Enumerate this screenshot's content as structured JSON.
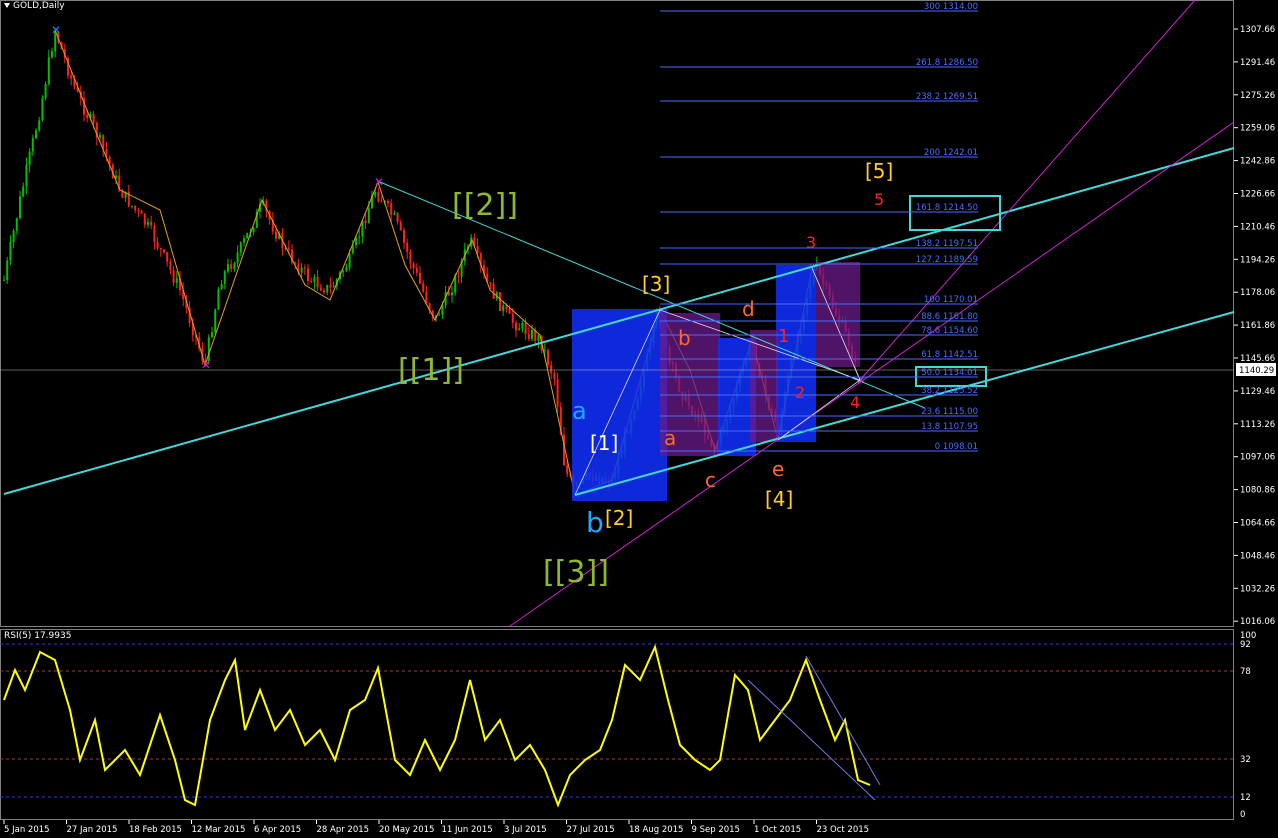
{
  "symbol_title": "GOLD,Daily",
  "rsi_title": "RSI(5) 17.9935",
  "current_price": "1140.29",
  "price_axis": [
    "1307.66",
    "1291.46",
    "1275.26",
    "1259.06",
    "1242.86",
    "1226.66",
    "1210.46",
    "1194.26",
    "1178.06",
    "1161.86",
    "1145.66",
    "1129.46",
    "1113.26",
    "1097.06",
    "1080.86",
    "1064.66",
    "1048.46",
    "1032.26",
    "1016.06"
  ],
  "rsi_axis": [
    "100",
    "92",
    "78",
    "32",
    "12",
    "0"
  ],
  "date_axis": [
    "5 Jan 2015",
    "27 Jan 2015",
    "18 Feb 2015",
    "12 Mar 2015",
    "6 Apr 2015",
    "28 Apr 2015",
    "20 May 2015",
    "11 Jun 2015",
    "3 Jul 2015",
    "27 Jul 2015",
    "18 Aug 2015",
    "9 Sep 2015",
    "1 Oct 2015",
    "23 Oct 2015"
  ],
  "fib_levels": [
    {
      "label": "300 1314.00"
    },
    {
      "label": "261.8 1286.50"
    },
    {
      "label": "238.2 1269.51"
    },
    {
      "label": "200 1242.01"
    },
    {
      "label": "161.8 1214.50"
    },
    {
      "label": "138.2 1197.51"
    },
    {
      "label": "127.2 1189.59"
    },
    {
      "label": "100 1170.01"
    },
    {
      "label": "88.6 1161.80"
    },
    {
      "label": "78.6 1154.60"
    },
    {
      "label": "61.8 1142.51"
    },
    {
      "label": "50.0 1134.01"
    },
    {
      "label": "38.2 1125.52"
    },
    {
      "label": "23.6 1115.00"
    },
    {
      "label": "13.8 1107.95"
    },
    {
      "label": "0 1098.01"
    }
  ],
  "wave_labels": {
    "w2_big": "[[2]]",
    "w1_big": "[[1]]",
    "w3_big": "[[3]]",
    "w3": "[3]",
    "w1": "[1]",
    "w2": "[2]",
    "w4": "[4]",
    "w5": "[5]",
    "a_blue": "a",
    "b_blue": "b",
    "a_red": "a",
    "b_red": "b",
    "c_red": "c",
    "d_red": "d",
    "e_red": "e",
    "n1": "1",
    "n2": "2",
    "n3": "3",
    "n4": "4",
    "n5": "5"
  },
  "colors": {
    "bull": "#00c000",
    "bear": "#ff2020",
    "fib": "#4a6cff",
    "cyan": "#40d8d8",
    "magenta": "#d020d0",
    "rsi": "#ffff00",
    "olive": "#8fb830",
    "gold": "#ffd020",
    "orange": "#ff6a20",
    "red": "#ff2020",
    "blue_label": "#20a8ff"
  }
}
